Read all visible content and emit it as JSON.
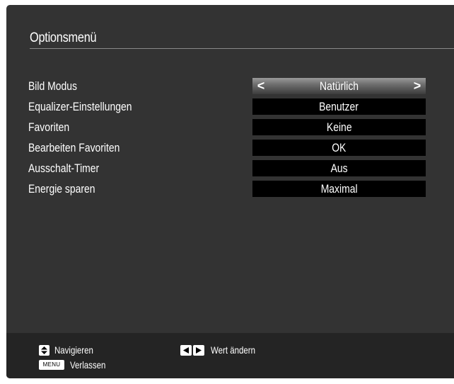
{
  "menu": {
    "title": "Optionsmenü"
  },
  "settings": [
    {
      "label": "Bild Modus",
      "value": "Natürlich",
      "selected": true
    },
    {
      "label": "Equalizer-Einstellungen",
      "value": "Benutzer",
      "selected": false
    },
    {
      "label": "Favoriten",
      "value": "Keine",
      "selected": false
    },
    {
      "label": "Bearbeiten Favoriten",
      "value": "OK",
      "selected": false
    },
    {
      "label": "Ausschalt-Timer",
      "value": "Aus",
      "selected": false
    },
    {
      "label": "Energie sparen",
      "value": "Maximal",
      "selected": false
    }
  ],
  "selector_arrows": {
    "left": "<",
    "right": ">"
  },
  "footer": {
    "navigate_label": "Navigieren",
    "change_value_label": "Wert ändern",
    "menu_key_label": "MENU",
    "exit_label": "Verlassen"
  },
  "colors": {
    "panel_background": "#333333",
    "footer_background": "#242424",
    "value_box_background": "#000000",
    "text": "#ffffff"
  },
  "icons": {
    "navigate": "up-down-arrow-key-icon",
    "change_value": "left-right-arrow-keys-icon",
    "exit": "menu-key-icon"
  }
}
